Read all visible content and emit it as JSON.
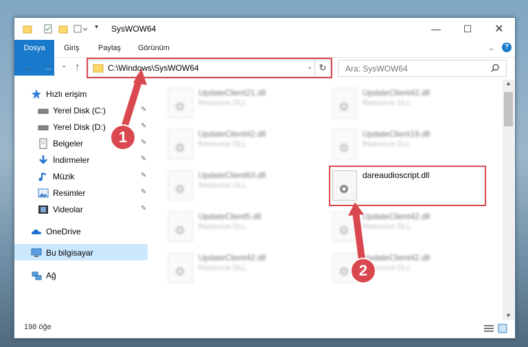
{
  "window": {
    "title": "SysWOW64"
  },
  "ribbon": {
    "tabs": [
      "Dosya",
      "Giriş",
      "Paylaş",
      "Görünüm"
    ]
  },
  "address": {
    "path": "C:\\Windows\\SysWOW64",
    "search_placeholder": "Ara: SysWOW64"
  },
  "sidebar": {
    "items": [
      {
        "label": "Hızlı erişim"
      },
      {
        "label": "Yerel Disk (C:)"
      },
      {
        "label": "Yerel Disk (D:)"
      },
      {
        "label": "Belgeler"
      },
      {
        "label": "İndirmeler"
      },
      {
        "label": "Müzik"
      },
      {
        "label": "Resimler"
      },
      {
        "label": "Videolar"
      },
      {
        "label": "OneDrive"
      },
      {
        "label": "Bu bilgisayar"
      },
      {
        "label": "Ağ"
      }
    ]
  },
  "files": [
    {
      "name": "UpdateClient21.dll",
      "type": "Resource DLL"
    },
    {
      "name": "UpdateClient42.dll",
      "type": "Resource DLL"
    },
    {
      "name": "UpdateClient42.dll",
      "type": "Resource DLL"
    },
    {
      "name": "UpdateClient19.dll",
      "type": "Resource DLL"
    },
    {
      "name": "UpdateClient63.dll",
      "type": "Resource DLL"
    },
    {
      "name": "dareaudioscript.dll",
      "type": ""
    },
    {
      "name": "UpdateClient5.dll",
      "type": "Resource DLL"
    },
    {
      "name": "UpdateClient42.dll",
      "type": "Resource DLL"
    },
    {
      "name": "UpdateClient42.dll",
      "type": "Resource DLL"
    },
    {
      "name": "UpdateClient42.dll",
      "type": "Resource DLL"
    }
  ],
  "status": {
    "count": "198 öğe"
  },
  "badges": {
    "one": "1",
    "two": "2"
  },
  "colors": {
    "accent": "#1979ca",
    "highlight": "#d9484f",
    "selected": "#cce8ff"
  }
}
